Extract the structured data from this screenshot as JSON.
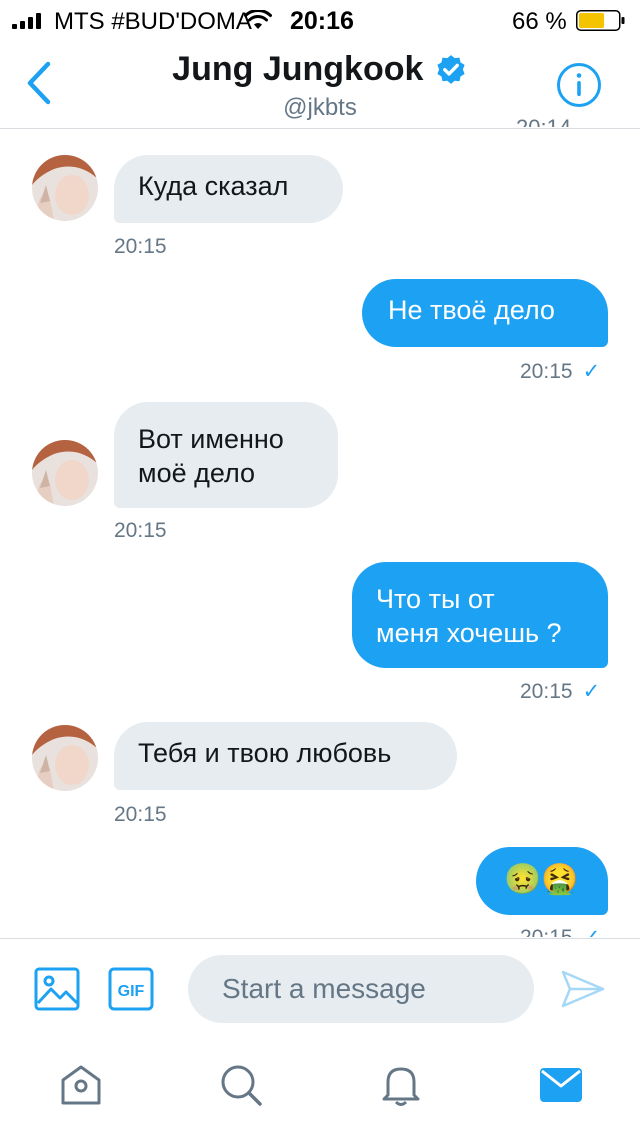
{
  "status_bar": {
    "carrier": "MTS #BUD'DOMA",
    "time": "20:16",
    "battery_percent": "66 %",
    "signal_icon": "signal-bars-icon",
    "wifi_icon": "wifi-icon",
    "battery_icon": "battery-icon",
    "battery_level": 0.66,
    "battery_color": "#f5c400"
  },
  "header": {
    "name": "Jung Jungkook",
    "handle": "@jkbts",
    "verified": true,
    "back_icon": "chevron-left-icon",
    "info_icon": "info-icon",
    "clipped_timestamp": "20:14"
  },
  "messages": [
    {
      "direction": "in",
      "lines": [
        "Куда сказал"
      ],
      "time": "20:15"
    },
    {
      "direction": "out",
      "lines": [
        "Не твоё дело"
      ],
      "time": "20:15",
      "read_mark": "✓"
    },
    {
      "direction": "in",
      "lines": [
        "Вот именно",
        "моё дело"
      ],
      "time": "20:15"
    },
    {
      "direction": "out",
      "lines": [
        "Что ты от",
        "меня хочешь ?"
      ],
      "time": "20:15",
      "read_mark": "✓"
    },
    {
      "direction": "in",
      "lines": [
        "Тебя и твою любовь"
      ],
      "time": "20:15"
    },
    {
      "direction": "out",
      "lines": [
        "🤢🤮"
      ],
      "time": "20:15",
      "read_mark": "✓"
    }
  ],
  "composer": {
    "placeholder": "Start a message",
    "media_icon": "image-icon",
    "gif_label": "GIF",
    "send_icon": "send-icon"
  },
  "tab_bar": {
    "items": [
      "home-icon",
      "search-icon",
      "notifications-icon",
      "messages-icon"
    ],
    "active": "messages-icon"
  },
  "colors": {
    "accent": "#1da1f2",
    "incoming_bubble": "#e6ecf0",
    "secondary_text": "#657786"
  }
}
